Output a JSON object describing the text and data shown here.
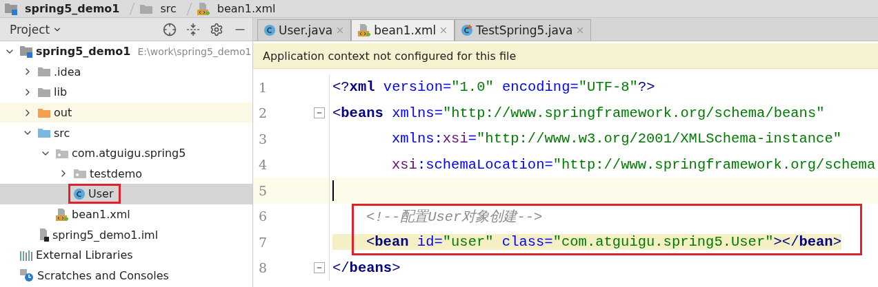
{
  "breadcrumb": [
    {
      "label": "spring5_demo1",
      "kind": "module"
    },
    {
      "label": "src",
      "kind": "folder"
    },
    {
      "label": "bean1.xml",
      "kind": "xml"
    }
  ],
  "project_panel": {
    "title": "Project",
    "tools": [
      {
        "kind": "locate"
      },
      {
        "kind": "collapse"
      },
      {
        "kind": "settings"
      },
      {
        "kind": "hide"
      }
    ]
  },
  "tree": [
    {
      "label": "spring5_demo1",
      "path": "E:\\work\\spring5_demo1",
      "kind": "module",
      "expanded": true,
      "selected": false,
      "highlighted": false,
      "children": [
        {
          "label": ".idea",
          "kind": "folder",
          "expanded": false,
          "selected": false,
          "highlighted": false
        },
        {
          "label": "lib",
          "kind": "folder",
          "expanded": false,
          "selected": false,
          "highlighted": false
        },
        {
          "label": "out",
          "kind": "excluded",
          "expanded": false,
          "selected": false,
          "highlighted": false
        },
        {
          "label": "src",
          "kind": "source",
          "expanded": true,
          "selected": false,
          "highlighted": false,
          "children": [
            {
              "label": "com.atguigu.spring5",
              "kind": "package",
              "expanded": true,
              "selected": false,
              "highlighted": false,
              "children": [
                {
                  "label": "testdemo",
                  "kind": "package",
                  "expanded": false,
                  "selected": false,
                  "highlighted": false
                },
                {
                  "label": "User",
                  "kind": "class",
                  "selected": true,
                  "highlighted": true
                }
              ]
            },
            {
              "label": "bean1.xml",
              "kind": "xml",
              "selected": false,
              "highlighted": false
            }
          ]
        },
        {
          "label": "spring5_demo1.iml",
          "kind": "iml",
          "selected": false,
          "highlighted": false
        }
      ]
    },
    {
      "label": "External Libraries",
      "kind": "libraries",
      "selected": false,
      "highlighted": false
    },
    {
      "label": "Scratches and Consoles",
      "kind": "scratches",
      "selected": false,
      "highlighted": false
    }
  ],
  "tabs": [
    {
      "label": "User.java",
      "kind": "class",
      "selected": false
    },
    {
      "label": "bean1.xml",
      "kind": "xml",
      "selected": true
    },
    {
      "label": "TestSpring5.java",
      "kind": "test",
      "selected": false
    }
  ],
  "banner": "Application context not configured for this file",
  "code": [
    {
      "number": "1",
      "current": false,
      "boxed": false,
      "fold": false,
      "indent": false,
      "continuation": false,
      "tokens": [
        {
          "text": "<?",
          "kind": "punct"
        },
        {
          "text": "xml ",
          "kind": "tag"
        },
        {
          "text": "version=",
          "kind": "attr"
        },
        {
          "text": "\"1.0\" ",
          "kind": "value"
        },
        {
          "text": "encoding=",
          "kind": "attr"
        },
        {
          "text": "\"UTF-8\"",
          "kind": "value"
        },
        {
          "text": "?>",
          "kind": "punct"
        }
      ]
    },
    {
      "number": "2",
      "current": false,
      "boxed": false,
      "fold": true,
      "indent": false,
      "continuation": false,
      "tokens": [
        {
          "text": "<",
          "kind": "punct"
        },
        {
          "text": "beans ",
          "kind": "tag"
        },
        {
          "text": "xmlns=",
          "kind": "attr"
        },
        {
          "text": "\"http://www.springframework.org/schema/beans\"",
          "kind": "value"
        }
      ]
    },
    {
      "number": "3",
      "current": false,
      "boxed": false,
      "fold": false,
      "indent": true,
      "continuation": true,
      "tokens": [
        {
          "text": "xmlns:",
          "kind": "attr"
        },
        {
          "text": "xsi",
          "kind": "ns"
        },
        {
          "text": "=",
          "kind": "attr"
        },
        {
          "text": "\"http://www.w3.org/2001/XMLSchema-instance\"",
          "kind": "value"
        }
      ]
    },
    {
      "number": "4",
      "current": false,
      "boxed": false,
      "fold": false,
      "indent": true,
      "continuation": true,
      "tokens": [
        {
          "text": "xsi",
          "kind": "ns"
        },
        {
          "text": ":schemaLocation=",
          "kind": "attr"
        },
        {
          "text": "\"http://www.springframework.org/schema",
          "kind": "value"
        }
      ]
    },
    {
      "number": "5",
      "current": true,
      "boxed": false,
      "fold": false
    },
    {
      "number": "6",
      "current": false,
      "boxed": true,
      "fold": false,
      "indent": true,
      "continuation": false,
      "tokens": [
        {
          "text": "<!--配置User对象创建-->",
          "kind": "comment"
        }
      ]
    },
    {
      "number": "7",
      "current": false,
      "boxed": true,
      "fold": false,
      "indent": true,
      "continuation": false,
      "tokens": [
        {
          "text": "<",
          "kind": "punct"
        },
        {
          "text": "bean ",
          "kind": "tag"
        },
        {
          "text": "id=",
          "kind": "attr"
        },
        {
          "text": "\"user\" ",
          "kind": "value"
        },
        {
          "text": "class=",
          "kind": "attr"
        },
        {
          "text": "\"com.atguigu.spring5.User\"",
          "kind": "value"
        },
        {
          "text": "></",
          "kind": "punct"
        },
        {
          "text": "bean",
          "kind": "tag"
        },
        {
          "text": ">",
          "kind": "punct"
        }
      ]
    },
    {
      "number": "8",
      "current": false,
      "boxed": false,
      "fold": true,
      "indent": false,
      "continuation": false,
      "tokens": [
        {
          "text": "</",
          "kind": "punct"
        },
        {
          "text": "beans",
          "kind": "tag"
        },
        {
          "text": ">",
          "kind": "punct"
        }
      ]
    }
  ]
}
